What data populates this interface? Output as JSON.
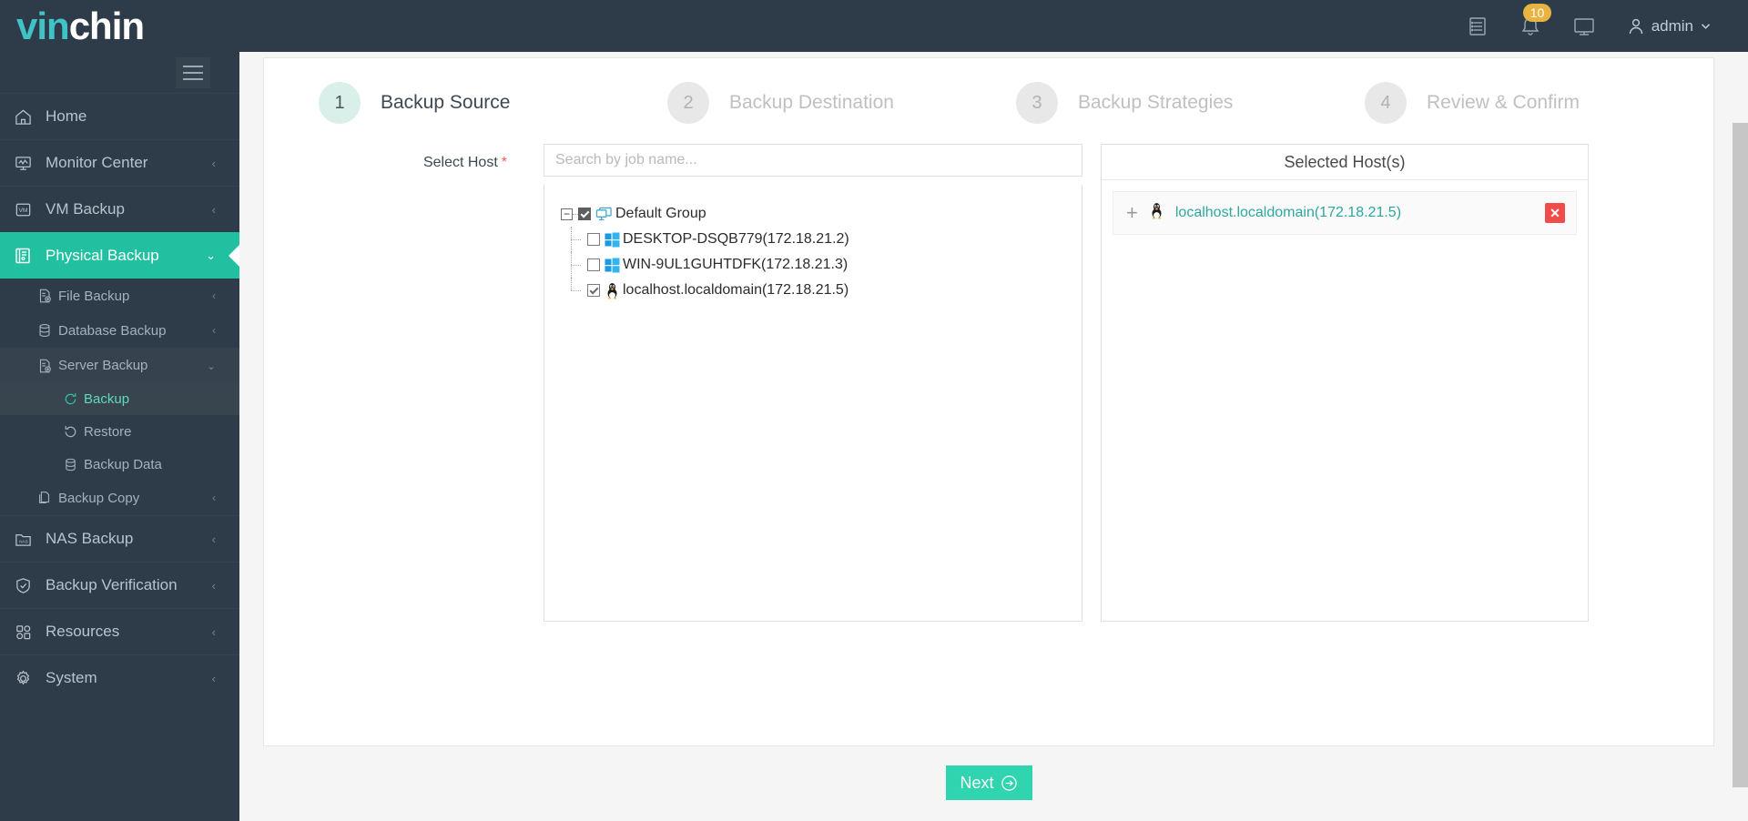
{
  "brand": {
    "prefix": "vin",
    "suffix": "chin"
  },
  "header": {
    "log_icon": "list-log-icon",
    "bell_icon": "bell-icon",
    "notification_count": "10",
    "console_icon": "monitor-icon",
    "user_icon": "user-icon",
    "user_name": "admin",
    "user_chevron": "chevron-down-icon"
  },
  "sidebar": {
    "toggle_icon": "hamburger-icon",
    "items": [
      {
        "label": "Home",
        "icon": "home-icon",
        "arrow": ""
      },
      {
        "label": "Monitor Center",
        "icon": "monitor-chart-icon",
        "arrow": "‹"
      },
      {
        "label": "VM Backup",
        "icon": "vm-icon",
        "arrow": "‹"
      },
      {
        "label": "Physical Backup",
        "icon": "physical-backup-icon",
        "arrow": "⌄"
      },
      {
        "label": "NAS Backup",
        "icon": "nas-icon",
        "arrow": "‹"
      },
      {
        "label": "Backup Verification",
        "icon": "shield-check-icon",
        "arrow": "‹"
      },
      {
        "label": "Resources",
        "icon": "grid-icon",
        "arrow": "‹"
      },
      {
        "label": "System",
        "icon": "gear-icon",
        "arrow": "‹"
      }
    ],
    "physical_children": [
      {
        "label": "File Backup",
        "icon": "file-plus-icon",
        "arrow": "‹"
      },
      {
        "label": "Database Backup",
        "icon": "database-icon",
        "arrow": "‹"
      },
      {
        "label": "Server Backup",
        "icon": "server-plus-icon",
        "arrow": "⌄"
      },
      {
        "label": "Backup Copy",
        "icon": "copy-icon",
        "arrow": "‹"
      }
    ],
    "server_children": [
      {
        "label": "Backup",
        "icon": "refresh-cw-icon"
      },
      {
        "label": "Restore",
        "icon": "undo-icon"
      },
      {
        "label": "Backup Data",
        "icon": "database-icon"
      }
    ]
  },
  "stepper": [
    {
      "num": "1",
      "label": "Backup Source"
    },
    {
      "num": "2",
      "label": "Backup Destination"
    },
    {
      "num": "3",
      "label": "Backup Strategies"
    },
    {
      "num": "4",
      "label": "Review & Confirm"
    }
  ],
  "form": {
    "select_host_label": "Select Host",
    "required_mark": "*",
    "search_placeholder": "Search by job name...",
    "search_value": ""
  },
  "tree": {
    "root": {
      "label": "Default Group",
      "icon": "group-monitor-icon",
      "expander": "−",
      "checked": true
    },
    "children": [
      {
        "label": "DESKTOP-DSQB779(172.18.21.2)",
        "icon": "windows-icon",
        "checked": false
      },
      {
        "label": "WIN-9UL1GUHTDFK(172.18.21.3)",
        "icon": "windows-icon",
        "checked": false
      },
      {
        "label": "localhost.localdomain(172.18.21.5)",
        "icon": "linux-tux-icon",
        "checked": true
      }
    ]
  },
  "selected_panel": {
    "title": "Selected Host(s)",
    "rows": [
      {
        "expand_icon": "plus-icon",
        "os_icon": "linux-tux-icon",
        "name": "localhost.localdomain(172.18.21.5)",
        "delete_icon": "close-x-icon"
      }
    ]
  },
  "footer": {
    "next_label": "Next",
    "next_icon": "arrow-right-circle-icon"
  },
  "colors": {
    "brand_teal": "#20c0a0",
    "topbar": "#2e3b49",
    "accent_link": "#2fa7a0",
    "badge": "#e8b341",
    "danger": "#ef4c4c",
    "next_button": "#30d5b0"
  }
}
